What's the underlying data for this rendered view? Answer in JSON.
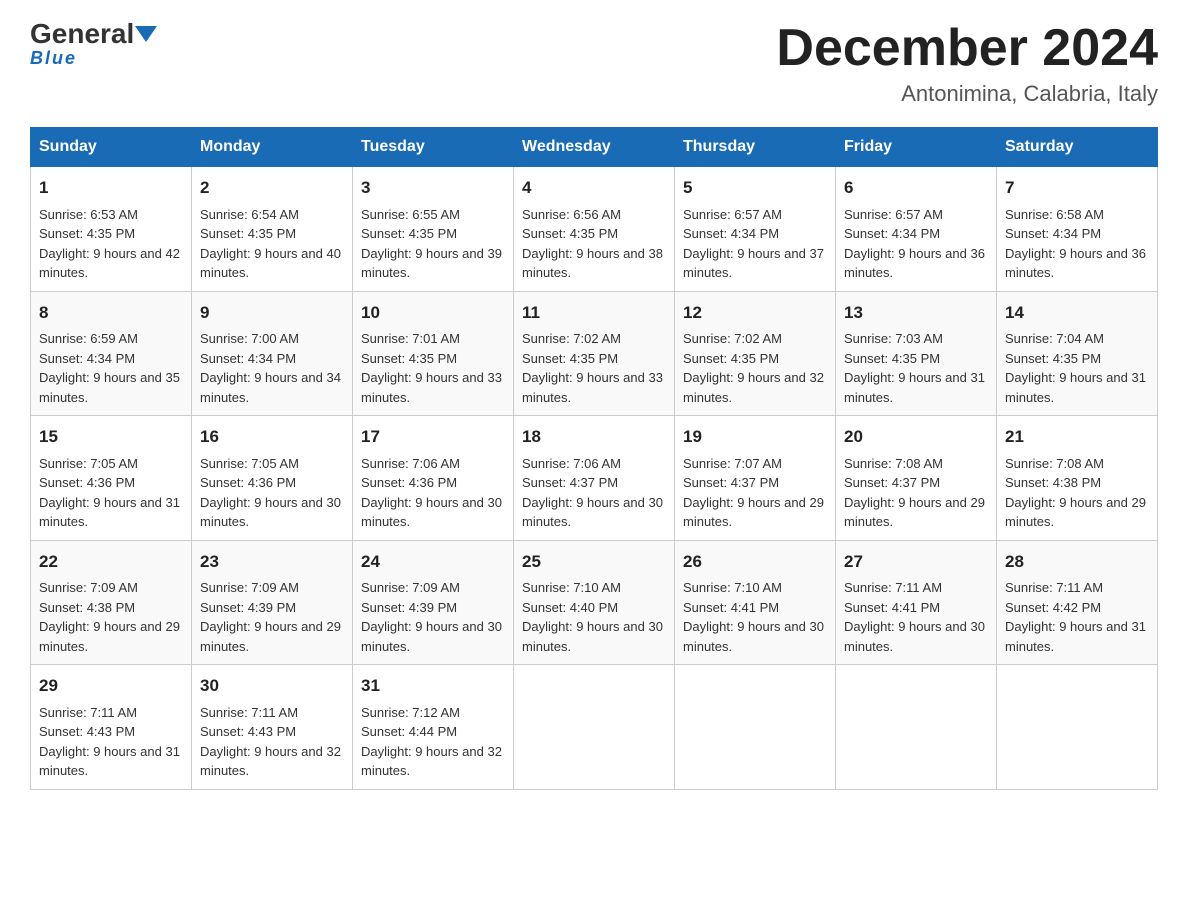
{
  "header": {
    "logo_general": "General",
    "logo_blue": "Blue",
    "month_title": "December 2024",
    "location": "Antonimina, Calabria, Italy"
  },
  "days_of_week": [
    "Sunday",
    "Monday",
    "Tuesday",
    "Wednesday",
    "Thursday",
    "Friday",
    "Saturday"
  ],
  "weeks": [
    [
      {
        "day": "1",
        "sunrise": "6:53 AM",
        "sunset": "4:35 PM",
        "daylight": "9 hours and 42 minutes."
      },
      {
        "day": "2",
        "sunrise": "6:54 AM",
        "sunset": "4:35 PM",
        "daylight": "9 hours and 40 minutes."
      },
      {
        "day": "3",
        "sunrise": "6:55 AM",
        "sunset": "4:35 PM",
        "daylight": "9 hours and 39 minutes."
      },
      {
        "day": "4",
        "sunrise": "6:56 AM",
        "sunset": "4:35 PM",
        "daylight": "9 hours and 38 minutes."
      },
      {
        "day": "5",
        "sunrise": "6:57 AM",
        "sunset": "4:34 PM",
        "daylight": "9 hours and 37 minutes."
      },
      {
        "day": "6",
        "sunrise": "6:57 AM",
        "sunset": "4:34 PM",
        "daylight": "9 hours and 36 minutes."
      },
      {
        "day": "7",
        "sunrise": "6:58 AM",
        "sunset": "4:34 PM",
        "daylight": "9 hours and 36 minutes."
      }
    ],
    [
      {
        "day": "8",
        "sunrise": "6:59 AM",
        "sunset": "4:34 PM",
        "daylight": "9 hours and 35 minutes."
      },
      {
        "day": "9",
        "sunrise": "7:00 AM",
        "sunset": "4:34 PM",
        "daylight": "9 hours and 34 minutes."
      },
      {
        "day": "10",
        "sunrise": "7:01 AM",
        "sunset": "4:35 PM",
        "daylight": "9 hours and 33 minutes."
      },
      {
        "day": "11",
        "sunrise": "7:02 AM",
        "sunset": "4:35 PM",
        "daylight": "9 hours and 33 minutes."
      },
      {
        "day": "12",
        "sunrise": "7:02 AM",
        "sunset": "4:35 PM",
        "daylight": "9 hours and 32 minutes."
      },
      {
        "day": "13",
        "sunrise": "7:03 AM",
        "sunset": "4:35 PM",
        "daylight": "9 hours and 31 minutes."
      },
      {
        "day": "14",
        "sunrise": "7:04 AM",
        "sunset": "4:35 PM",
        "daylight": "9 hours and 31 minutes."
      }
    ],
    [
      {
        "day": "15",
        "sunrise": "7:05 AM",
        "sunset": "4:36 PM",
        "daylight": "9 hours and 31 minutes."
      },
      {
        "day": "16",
        "sunrise": "7:05 AM",
        "sunset": "4:36 PM",
        "daylight": "9 hours and 30 minutes."
      },
      {
        "day": "17",
        "sunrise": "7:06 AM",
        "sunset": "4:36 PM",
        "daylight": "9 hours and 30 minutes."
      },
      {
        "day": "18",
        "sunrise": "7:06 AM",
        "sunset": "4:37 PM",
        "daylight": "9 hours and 30 minutes."
      },
      {
        "day": "19",
        "sunrise": "7:07 AM",
        "sunset": "4:37 PM",
        "daylight": "9 hours and 29 minutes."
      },
      {
        "day": "20",
        "sunrise": "7:08 AM",
        "sunset": "4:37 PM",
        "daylight": "9 hours and 29 minutes."
      },
      {
        "day": "21",
        "sunrise": "7:08 AM",
        "sunset": "4:38 PM",
        "daylight": "9 hours and 29 minutes."
      }
    ],
    [
      {
        "day": "22",
        "sunrise": "7:09 AM",
        "sunset": "4:38 PM",
        "daylight": "9 hours and 29 minutes."
      },
      {
        "day": "23",
        "sunrise": "7:09 AM",
        "sunset": "4:39 PM",
        "daylight": "9 hours and 29 minutes."
      },
      {
        "day": "24",
        "sunrise": "7:09 AM",
        "sunset": "4:39 PM",
        "daylight": "9 hours and 30 minutes."
      },
      {
        "day": "25",
        "sunrise": "7:10 AM",
        "sunset": "4:40 PM",
        "daylight": "9 hours and 30 minutes."
      },
      {
        "day": "26",
        "sunrise": "7:10 AM",
        "sunset": "4:41 PM",
        "daylight": "9 hours and 30 minutes."
      },
      {
        "day": "27",
        "sunrise": "7:11 AM",
        "sunset": "4:41 PM",
        "daylight": "9 hours and 30 minutes."
      },
      {
        "day": "28",
        "sunrise": "7:11 AM",
        "sunset": "4:42 PM",
        "daylight": "9 hours and 31 minutes."
      }
    ],
    [
      {
        "day": "29",
        "sunrise": "7:11 AM",
        "sunset": "4:43 PM",
        "daylight": "9 hours and 31 minutes."
      },
      {
        "day": "30",
        "sunrise": "7:11 AM",
        "sunset": "4:43 PM",
        "daylight": "9 hours and 32 minutes."
      },
      {
        "day": "31",
        "sunrise": "7:12 AM",
        "sunset": "4:44 PM",
        "daylight": "9 hours and 32 minutes."
      },
      null,
      null,
      null,
      null
    ]
  ]
}
